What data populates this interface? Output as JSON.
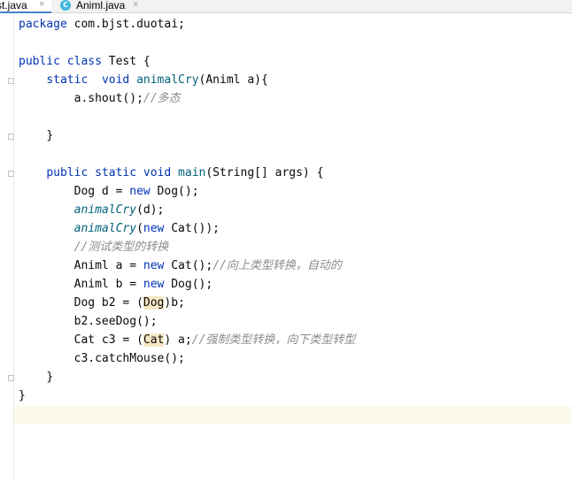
{
  "tabs": [
    {
      "label": "st.java",
      "close": "×",
      "active": true
    },
    {
      "label": "Animl.java",
      "close": "×",
      "icon": "c-class-icon",
      "icon_letter": "C",
      "active": false
    }
  ],
  "colors": {
    "keyword": "#0033b3",
    "method": "#00627a",
    "comment": "#8c8c8c",
    "current_line": "#fcfaed",
    "highlight": "#f5e7c3"
  },
  "code": {
    "l1": {
      "kw": "package",
      "rest": " com.bjst.duotai;"
    },
    "l3": {
      "kw1": "public",
      "kw2": "class",
      "rest": " Test {"
    },
    "l4": {
      "kw1": "static",
      "kw2": "void",
      "name": "animalCry",
      "rest": "(Animl a){"
    },
    "l5": {
      "code": "a.shout();",
      "comment": "//多态"
    },
    "l6": "}",
    "l8": {
      "kw1": "public",
      "kw2": "static",
      "kw3": "void",
      "name": "main",
      "rest": "(String[] args) {"
    },
    "l9": {
      "a": "Dog d = ",
      "kw": "new",
      "b": " Dog();"
    },
    "l10": {
      "name": "animalCry",
      "rest": "(d);"
    },
    "l11": {
      "name": "animalCry",
      "rest": "(",
      "kw": "new",
      "rest2": " Cat());"
    },
    "l12": {
      "comment": "//测试类型的转换"
    },
    "l13": {
      "a": "Animl a = ",
      "kw": "new",
      "b": " Cat();",
      "comment": "//向上类型转换，自动的"
    },
    "l14": {
      "a": "Animl b = ",
      "kw": "new",
      "b": " Dog();"
    },
    "l15": {
      "a": "Dog b2 = (",
      "hl": "Dog",
      "b": ")b;"
    },
    "l16": "b2.seeDog();",
    "l17": {
      "a": "Cat c3 = (",
      "hl": "Cat",
      "b": ") a;",
      "comment": "//强制类型转换，向下类型转型"
    },
    "l18": "c3.catchMouse();",
    "l19": "}",
    "l20": "}"
  }
}
